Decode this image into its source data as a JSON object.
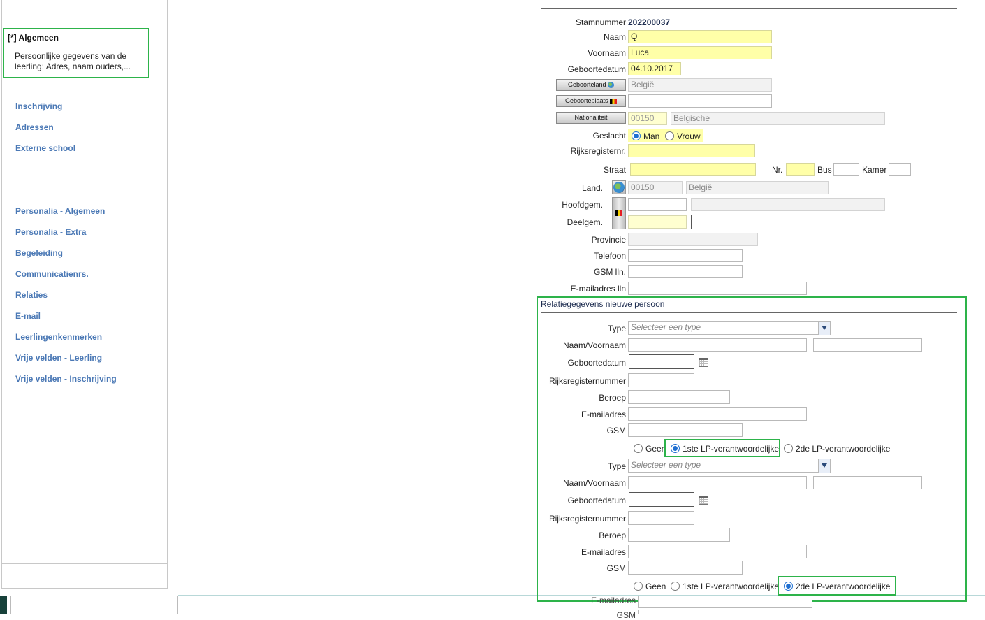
{
  "sidebar": {
    "selected": {
      "title": "[*] Algemeen",
      "desc": "Persoonlijke gegevens van de leerling: Adres, naam ouders,..."
    },
    "items": [
      "Inschrijving",
      "Adressen",
      "Externe school",
      "Personalia - Algemeen",
      "Personalia - Extra",
      "Begeleiding",
      "Communicatienrs.",
      "Relaties",
      "E-mail",
      "Leerlingenkenmerken",
      "Vrije velden - Leerling",
      "Vrije velden - Inschrijving"
    ]
  },
  "form": {
    "stamnummer_label": "Stamnummer",
    "stamnummer": "202200037",
    "naam_label": "Naam",
    "naam": "Q",
    "voornaam_label": "Voornaam",
    "voornaam": "Luca",
    "geboortedatum_label": "Geboortedatum",
    "geboortedatum": "04.10.2017",
    "geboorteland_btn": "Geboorteland",
    "geboorteland": "België",
    "geboorteplaats_btn": "Geboorteplaats",
    "nationaliteit_btn": "Nationaliteit",
    "nat_code": "00150",
    "nat_name": "Belgische",
    "geslacht_label": "Geslacht",
    "man": "Man",
    "vrouw": "Vrouw",
    "rijks_label": "Rijksregisternr.",
    "straat_label": "Straat",
    "nr_label": "Nr.",
    "bus_label": "Bus",
    "kamer_label": "Kamer",
    "land_label": "Land.",
    "land_code": "00150",
    "land_name": "België",
    "hoofdgem_label": "Hoofdgem.",
    "deelgem_label": "Deelgem.",
    "provincie_label": "Provincie",
    "telefoon_label": "Telefoon",
    "gsm_label": "GSM lln.",
    "email_label": "E-mailadres lln"
  },
  "relatie": {
    "title": "Relatiegegevens nieuwe persoon",
    "type_label": "Type",
    "type_placeholder": "Selecteer een type",
    "naam_label": "Naam/Voornaam",
    "geb_label": "Geboortedatum",
    "rijks_label": "Rijksregisternummer",
    "beroep_label": "Beroep",
    "email_label": "E-mailadres",
    "gsm_label": "GSM",
    "opt_geen": "Geen",
    "opt_1ste": "1ste LP-verantwoordelijke",
    "opt_2de": "2de LP-verantwoordelijke"
  },
  "below": {
    "email_label": "E-mailadres",
    "gsm_label": "GSM"
  }
}
